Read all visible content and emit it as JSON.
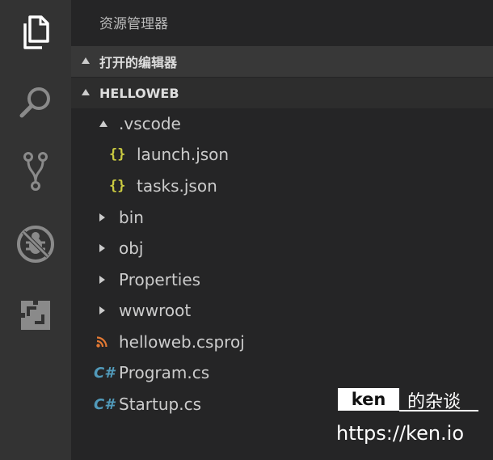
{
  "activity_bar": {
    "items": [
      {
        "icon": "files-icon",
        "active": true
      },
      {
        "icon": "search-icon",
        "active": false
      },
      {
        "icon": "source-control-icon",
        "active": false
      },
      {
        "icon": "debug-icon",
        "active": false
      },
      {
        "icon": "extensions-icon",
        "active": false
      }
    ]
  },
  "explorer": {
    "title": "资源管理器",
    "open_editors_label": "打开的编辑器",
    "project_label": "HELLOWEB",
    "tree": [
      {
        "label": ".vscode",
        "type": "folder",
        "expanded": true
      },
      {
        "label": "launch.json",
        "type": "json",
        "icon_text": "{}"
      },
      {
        "label": "tasks.json",
        "type": "json",
        "icon_text": "{}"
      },
      {
        "label": "bin",
        "type": "folder",
        "expanded": false
      },
      {
        "label": "obj",
        "type": "folder",
        "expanded": false
      },
      {
        "label": "Properties",
        "type": "folder",
        "expanded": false
      },
      {
        "label": "wwwroot",
        "type": "folder",
        "expanded": false
      },
      {
        "label": "helloweb.csproj",
        "type": "rss"
      },
      {
        "label": "Program.cs",
        "type": "csharp",
        "icon_text": "C#"
      },
      {
        "label": "Startup.cs",
        "type": "csharp",
        "icon_text": "C#"
      }
    ]
  },
  "watermark": {
    "brand": "ken",
    "suffix": "的杂谈",
    "url": "https://ken.io"
  },
  "colors": {
    "activity_bg": "#333333",
    "sidebar_bg": "#252526",
    "section_bg": "#383838",
    "json_icon": "#cbcb41",
    "csharp_icon": "#519aba",
    "rss_icon": "#e37933"
  }
}
